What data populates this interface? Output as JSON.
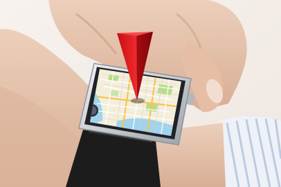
{
  "scene": {
    "subject": "smartwatch-map-photo",
    "colors": {
      "background": "#f4efea",
      "skin": "#e7c4ad",
      "skin_shadow": "#cfa58b",
      "strap": "#1c1c1c",
      "bezel": "#d5d8dc",
      "map_water": "#9fd3ef",
      "map_land": "#f3eedc",
      "map_park": "#b7dd8a",
      "pin": "#e2141a",
      "shirt": "#eef2f8",
      "shirt_stripe": "#b8c6dc"
    },
    "icons": [
      "map-pin-icon",
      "compass-icon"
    ]
  }
}
